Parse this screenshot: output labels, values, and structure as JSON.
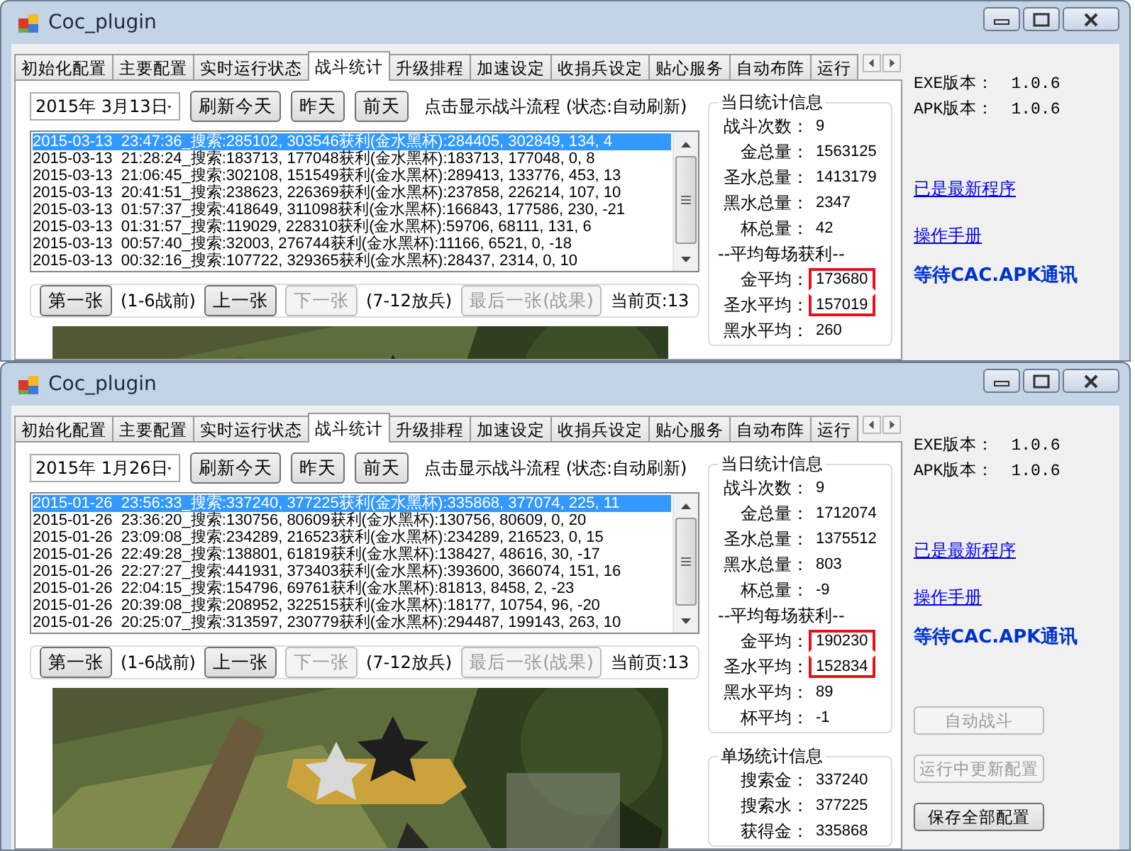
{
  "windows": [
    {
      "title": "Coc_plugin",
      "tabs": [
        {
          "label": "初始化配置",
          "selected": false
        },
        {
          "label": "主要配置",
          "selected": false
        },
        {
          "label": "实时运行状态",
          "selected": false
        },
        {
          "label": "战斗统计",
          "selected": true
        },
        {
          "label": "升级排程",
          "selected": false
        },
        {
          "label": "加速设定",
          "selected": false
        },
        {
          "label": "收捐兵设定",
          "selected": false
        },
        {
          "label": "贴心服务",
          "selected": false
        },
        {
          "label": "自动布阵",
          "selected": false
        },
        {
          "label": "运行",
          "selected": false
        }
      ],
      "date": "2015年  3月13日",
      "day_buttons": [
        "刷新今天",
        "昨天",
        "前天"
      ],
      "hint": "点击显示战斗流程 (状态:自动刷新)",
      "log": [
        {
          "text": "2015-03-13  23:47:36_搜索:285102, 303546获利(金水黑杯):284405, 302849, 134, 4",
          "selected": true
        },
        {
          "text": "2015-03-13  21:28:24_搜索:183713, 177048获利(金水黑杯):183713, 177048, 0, 8",
          "selected": false
        },
        {
          "text": "2015-03-13  21:06:45_搜索:302108, 151549获利(金水黑杯):289413, 133776, 453, 13",
          "selected": false
        },
        {
          "text": "2015-03-13  20:41:51_搜索:238623, 226369获利(金水黑杯):237858, 226214, 107, 10",
          "selected": false
        },
        {
          "text": "2015-03-13  01:57:37_搜索:418649, 311098获利(金水黑杯):166843, 177586, 230, -21",
          "selected": false
        },
        {
          "text": "2015-03-13  01:31:57_搜索:119029, 228310获利(金水黑杯):59706, 68111, 131, 6",
          "selected": false
        },
        {
          "text": "2015-03-13  00:57:40_搜索:32003, 276744获利(金水黑杯):11166, 6521, 0, -18",
          "selected": false
        },
        {
          "text": "2015-03-13  00:32:16_搜索:107722, 329365获利(金水黑杯):28437, 2314, 0, 10",
          "selected": false
        }
      ],
      "nav": [
        {
          "kind": "button",
          "label": "第一张",
          "disabled": false
        },
        {
          "kind": "note",
          "label": "(1-6战前)"
        },
        {
          "kind": "button",
          "label": "上一张",
          "disabled": false
        },
        {
          "kind": "button",
          "label": "下一张",
          "disabled": true
        },
        {
          "kind": "note",
          "label": "(7-12放兵)"
        },
        {
          "kind": "button",
          "label": "最后一张(战果)",
          "disabled": true
        },
        {
          "kind": "note",
          "label": "当前页:13"
        }
      ],
      "stat_groups": [
        {
          "title": "当日统计信息",
          "rows": [
            {
              "kind": "stat",
              "label": "战斗次数：",
              "value": "9",
              "boxed": false
            },
            {
              "kind": "stat",
              "label": "金总量：",
              "value": "1563125",
              "boxed": false
            },
            {
              "kind": "stat",
              "label": "圣水总量：",
              "value": "1413179",
              "boxed": false
            },
            {
              "kind": "stat",
              "label": "黑水总量：",
              "value": "2347",
              "boxed": false
            },
            {
              "kind": "stat",
              "label": "杯总量：",
              "value": "42",
              "boxed": false
            },
            {
              "kind": "heading",
              "label": "--平均每场获利--"
            },
            {
              "kind": "stat",
              "label": "金平均：",
              "value": "173680",
              "boxed": true
            },
            {
              "kind": "stat",
              "label": "圣水平均：",
              "value": "157019",
              "boxed": true
            },
            {
              "kind": "stat",
              "label": "黑水平均：",
              "value": "260",
              "boxed": false
            }
          ]
        }
      ],
      "versions": [
        {
          "label": "EXE版本：",
          "value": "1.0.6"
        },
        {
          "label": "APK版本：",
          "value": "1.0.6"
        }
      ],
      "links": [
        "已是最新程序",
        "操作手册"
      ],
      "status": "等待CAC.APK通讯"
    },
    {
      "title": "Coc_plugin",
      "tabs": [
        {
          "label": "初始化配置",
          "selected": false
        },
        {
          "label": "主要配置",
          "selected": false
        },
        {
          "label": "实时运行状态",
          "selected": false
        },
        {
          "label": "战斗统计",
          "selected": true
        },
        {
          "label": "升级排程",
          "selected": false
        },
        {
          "label": "加速设定",
          "selected": false
        },
        {
          "label": "收捐兵设定",
          "selected": false
        },
        {
          "label": "贴心服务",
          "selected": false
        },
        {
          "label": "自动布阵",
          "selected": false
        },
        {
          "label": "运行",
          "selected": false
        }
      ],
      "date": "2015年  1月26日",
      "day_buttons": [
        "刷新今天",
        "昨天",
        "前天"
      ],
      "hint": "点击显示战斗流程 (状态:自动刷新)",
      "log": [
        {
          "text": "2015-01-26  23:56:33_搜索:337240, 377225获利(金水黑杯):335868, 377074, 225, 11",
          "selected": true
        },
        {
          "text": "2015-01-26  23:36:20_搜索:130756, 80609获利(金水黑杯):130756, 80609, 0, 20",
          "selected": false
        },
        {
          "text": "2015-01-26  23:09:08_搜索:234289, 216523获利(金水黑杯):234289, 216523, 0, 15",
          "selected": false
        },
        {
          "text": "2015-01-26  22:49:28_搜索:138801, 61819获利(金水黑杯):138427, 48616, 30, -17",
          "selected": false
        },
        {
          "text": "2015-01-26  22:27:27_搜索:441931, 373403获利(金水黑杯):393600, 366074, 151, 16",
          "selected": false
        },
        {
          "text": "2015-01-26  22:04:15_搜索:154796, 69761获利(金水黑杯):81813, 8458, 2, -23",
          "selected": false
        },
        {
          "text": "2015-01-26  20:39:08_搜索:208952, 322515获利(金水黑杯):18177, 10754, 96, -20",
          "selected": false
        },
        {
          "text": "2015-01-26  20:25:07_搜索:313597, 230779获利(金水黑杯):294487, 199143, 263, 10",
          "selected": false
        }
      ],
      "nav": [
        {
          "kind": "button",
          "label": "第一张",
          "disabled": false
        },
        {
          "kind": "note",
          "label": "(1-6战前)"
        },
        {
          "kind": "button",
          "label": "上一张",
          "disabled": false
        },
        {
          "kind": "button",
          "label": "下一张",
          "disabled": true
        },
        {
          "kind": "note",
          "label": "(7-12放兵)"
        },
        {
          "kind": "button",
          "label": "最后一张(战果)",
          "disabled": true
        },
        {
          "kind": "note",
          "label": "当前页:13"
        }
      ],
      "stat_groups": [
        {
          "title": "当日统计信息",
          "rows": [
            {
              "kind": "stat",
              "label": "战斗次数：",
              "value": "9",
              "boxed": false
            },
            {
              "kind": "stat",
              "label": "金总量：",
              "value": "1712074",
              "boxed": false
            },
            {
              "kind": "stat",
              "label": "圣水总量：",
              "value": "1375512",
              "boxed": false
            },
            {
              "kind": "stat",
              "label": "黑水总量：",
              "value": "803",
              "boxed": false
            },
            {
              "kind": "stat",
              "label": "杯总量：",
              "value": "-9",
              "boxed": false
            },
            {
              "kind": "heading",
              "label": "--平均每场获利--"
            },
            {
              "kind": "stat",
              "label": "金平均：",
              "value": "190230",
              "boxed": true
            },
            {
              "kind": "stat",
              "label": "圣水平均：",
              "value": "152834",
              "boxed": true
            },
            {
              "kind": "stat",
              "label": "黑水平均：",
              "value": "89",
              "boxed": false
            },
            {
              "kind": "stat",
              "label": "杯平均：",
              "value": "-1",
              "boxed": false
            }
          ]
        },
        {
          "title": "单场统计信息",
          "rows": [
            {
              "kind": "stat",
              "label": "搜索金：",
              "value": "337240",
              "boxed": false
            },
            {
              "kind": "stat",
              "label": "搜索水：",
              "value": "377225",
              "boxed": false
            },
            {
              "kind": "stat",
              "label": "获得金：",
              "value": "335868",
              "boxed": false
            }
          ]
        }
      ],
      "versions": [
        {
          "label": "EXE版本：",
          "value": "1.0.6"
        },
        {
          "label": "APK版本：",
          "value": "1.0.6"
        }
      ],
      "links": [
        "已是最新程序",
        "操作手册"
      ],
      "status": "等待CAC.APK通讯",
      "actions": [
        {
          "label": "自动战斗",
          "disabled": true
        },
        {
          "label": "运行中更新配置",
          "disabled": true
        },
        {
          "label": "保存全部配置",
          "disabled": false
        }
      ]
    }
  ]
}
